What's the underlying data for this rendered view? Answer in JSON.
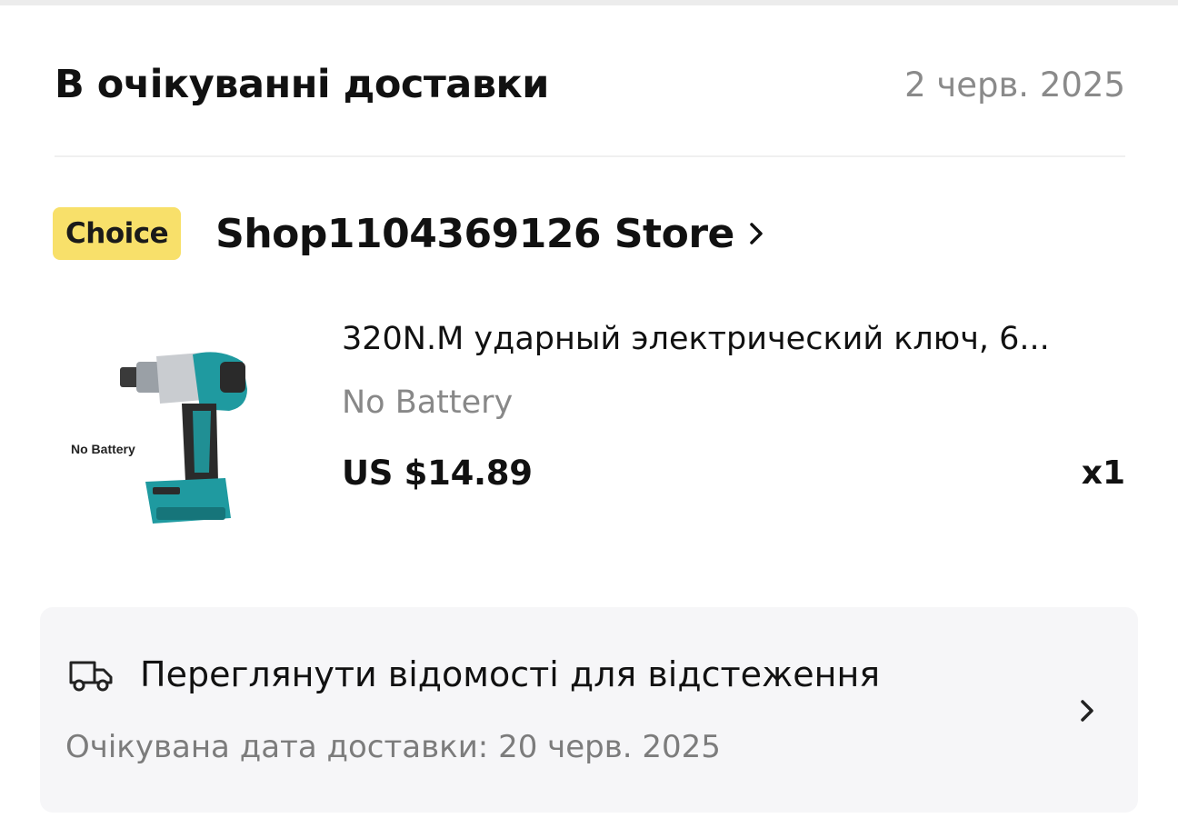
{
  "order": {
    "status_title": "В очікуванні доставки",
    "date": "2 черв. 2025"
  },
  "store": {
    "badge": "Choice",
    "name": "Shop1104369126 Store"
  },
  "product": {
    "title": "320N.M ударный электрический ключ, 6...",
    "image_label": "No Battery",
    "variant": "No Battery",
    "price": "US $14.89",
    "quantity": "x1"
  },
  "tracking": {
    "label": "Переглянути відомості для відстеження",
    "eta": "Очікувана дата доставки: 20 черв. 2025"
  },
  "icons": {
    "store_chevron": "chevron-right-icon",
    "truck": "truck-icon",
    "tracking_chevron": "chevron-right-icon"
  },
  "colors": {
    "choice_badge": "#f8e06a",
    "product_teal": "#1f9aa0",
    "muted_text": "#888888",
    "card_bg": "#f6f6f8"
  }
}
